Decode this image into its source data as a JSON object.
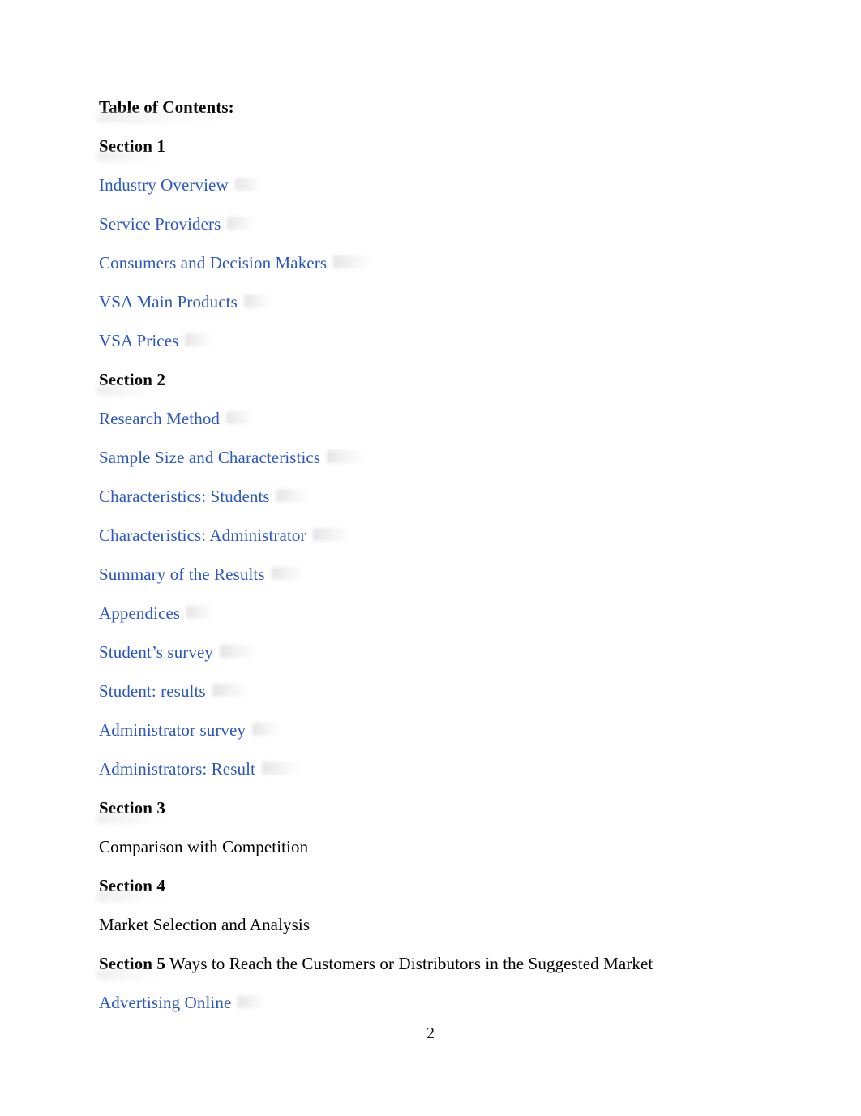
{
  "document": {
    "title": "Table of Contents:",
    "page_number": "2",
    "link_color": "#2a57c4",
    "text_color": "#000000"
  },
  "toc": {
    "entries": [
      {
        "text": "Table of Contents:",
        "style": "heading"
      },
      {
        "text": "Section 1",
        "style": "heading"
      },
      {
        "text": "Industry Overview",
        "style": "link"
      },
      {
        "text": "Service Providers",
        "style": "link"
      },
      {
        "text": "Consumers and Decision Makers",
        "style": "link"
      },
      {
        "text": "VSA Main Products",
        "style": "link"
      },
      {
        "text": "VSA Prices",
        "style": "link"
      },
      {
        "text": "Section 2",
        "style": "heading"
      },
      {
        "text": "Research Method",
        "style": "link"
      },
      {
        "text": "Sample Size and Characteristics",
        "style": "link"
      },
      {
        "text": "Characteristics: Students",
        "style": "link"
      },
      {
        "text": "Characteristics: Administrator",
        "style": "link"
      },
      {
        "text": "Summary of the Results",
        "style": "link"
      },
      {
        "text": "Appendices",
        "style": "link"
      },
      {
        "text": "Student’s survey",
        "style": "link"
      },
      {
        "text": "Student: results",
        "style": "link"
      },
      {
        "text": "Administrator survey",
        "style": "link"
      },
      {
        "text": "Administrators: Result",
        "style": "link"
      },
      {
        "text": "Section 3",
        "style": "heading"
      },
      {
        "text": "Comparison with Competition",
        "style": "plain"
      },
      {
        "text": "Section 4",
        "style": "heading"
      },
      {
        "text": "Market Selection and Analysis",
        "style": "plain"
      },
      {
        "label": "Section 5",
        "text": " Ways to Reach the Customers or Distributors in the Suggested Market",
        "style": "mixed"
      },
      {
        "text": "Advertising Online",
        "style": "link"
      }
    ]
  }
}
